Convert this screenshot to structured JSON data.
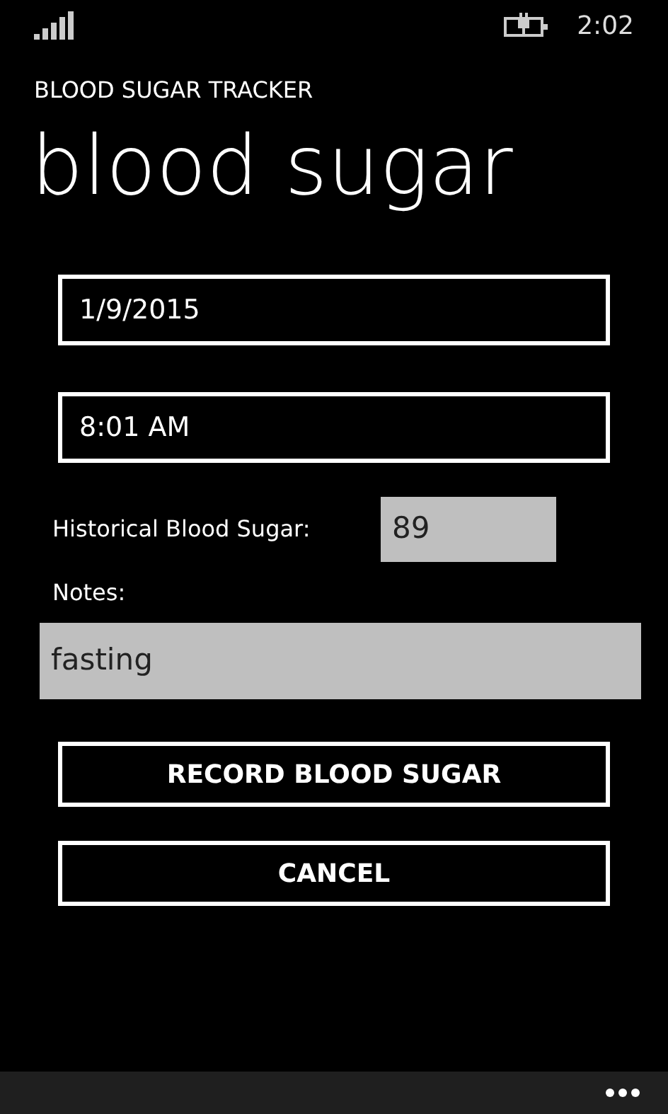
{
  "status_bar": {
    "time": "2:02"
  },
  "app_title": "BLOOD SUGAR TRACKER",
  "page_title": "blood sugar",
  "date_field": {
    "value": "1/9/2015"
  },
  "time_field": {
    "value": "8:01 AM"
  },
  "historical": {
    "label": "Historical Blood Sugar:",
    "value": "89"
  },
  "notes": {
    "label": "Notes:",
    "value": "fasting"
  },
  "buttons": [
    "RECORD BLOOD SUGAR",
    "CANCEL"
  ]
}
